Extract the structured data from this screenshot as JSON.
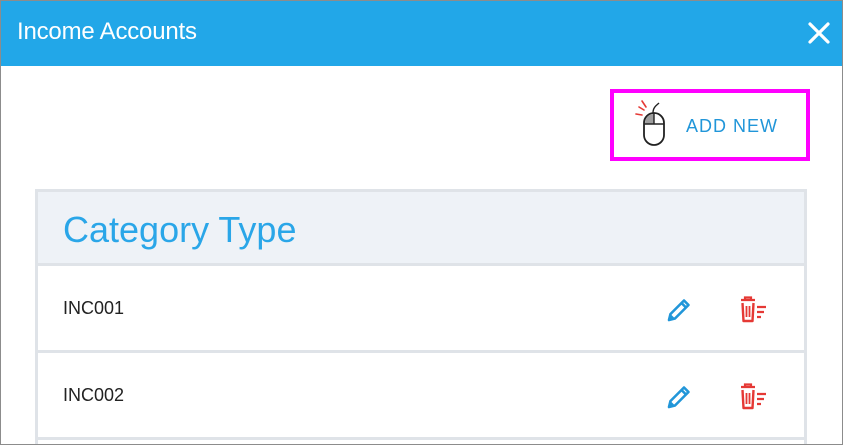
{
  "dialog": {
    "title": "Income Accounts",
    "close_icon": "close-icon",
    "header_color": "#22a7e8"
  },
  "toolbar": {
    "add_new_label": "ADD NEW",
    "add_new_icon": "mouse-click-icon",
    "highlight_color": "#ff00ff"
  },
  "table": {
    "header": "Category Type",
    "rows": [
      {
        "label": "INC001",
        "edit_icon": "pencil-icon",
        "delete_icon": "trash-icon"
      },
      {
        "label": "INC002",
        "edit_icon": "pencil-icon",
        "delete_icon": "trash-icon"
      }
    ],
    "accent_color": "#2aa6e8",
    "edit_color": "#2196d9",
    "delete_color": "#e53935"
  }
}
